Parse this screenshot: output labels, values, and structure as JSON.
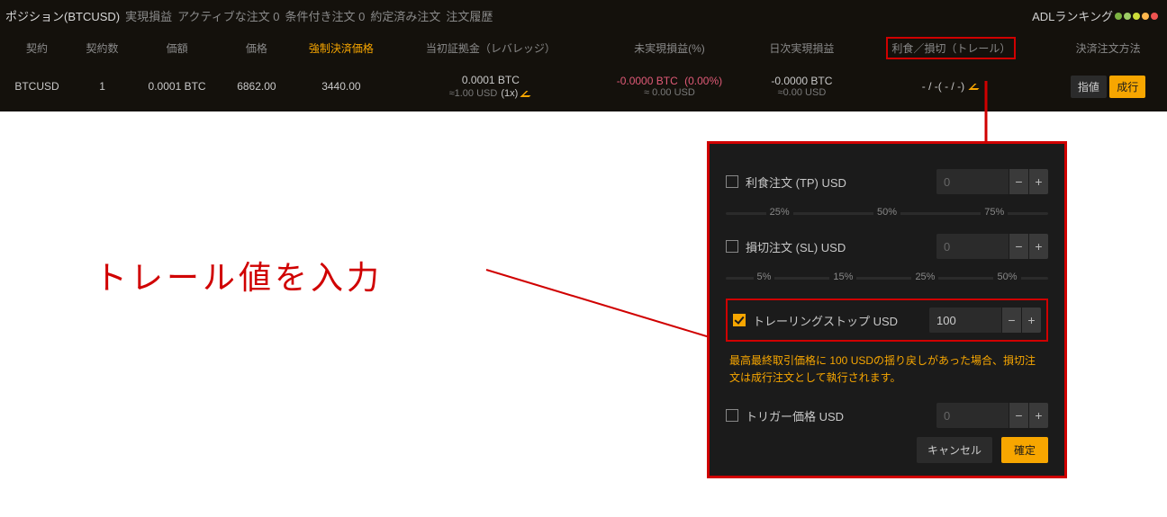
{
  "tabs": {
    "position": "ポジション(BTCUSD)",
    "realized": "実現損益",
    "active_orders": "アクティブな注文 0",
    "conditional": "条件付き注文 0",
    "filled": "約定済み注文",
    "history": "注文履歴"
  },
  "adl_label": "ADLランキング",
  "headers": {
    "contract": "契約",
    "qty": "契約数",
    "value": "価額",
    "price": "価格",
    "liq": "強制決済価格",
    "margin": "当初証拠金（レバレッジ）",
    "upnl": "未実現損益(%)",
    "daily": "日次実現損益",
    "tpsl": "利食／損切（トレール）",
    "close": "決済注文方法"
  },
  "row": {
    "symbol": "BTCUSD",
    "qty": "1",
    "value": "0.0001 BTC",
    "price": "6862.00",
    "liq": "3440.00",
    "margin_btc": "0.0001 BTC",
    "margin_usd": "≈1.00 USD",
    "leverage": "(1x)",
    "upnl_btc": "-0.0000 BTC",
    "upnl_usd": "≈ 0.00 USD",
    "upnl_pct": "(0.00%)",
    "daily_btc": "-0.0000 BTC",
    "daily_usd": "≈0.00 USD",
    "tpsl": "- / -( - / -)",
    "btn_limit": "指値",
    "btn_market": "成行"
  },
  "annotation": "トレール値を入力",
  "popup": {
    "tp_label": "利食注文 (TP)  USD",
    "tp_value": "",
    "tp_placeholder": "0",
    "tp_pcts": [
      "25%",
      "50%",
      "75%"
    ],
    "sl_label": "損切注文 (SL)  USD",
    "sl_value": "",
    "sl_placeholder": "0",
    "sl_pcts": [
      "5%",
      "15%",
      "25%",
      "50%"
    ],
    "ts_label": "トレーリングストップ  USD",
    "ts_value": "100",
    "note": "最高最終取引価格に 100 USDの揺り戻しがあった場合、損切注文は成行注文として執行されます。",
    "trigger_label": "トリガー価格  USD",
    "trigger_value": "",
    "trigger_placeholder": "0",
    "cancel": "キャンセル",
    "confirm": "確定"
  }
}
